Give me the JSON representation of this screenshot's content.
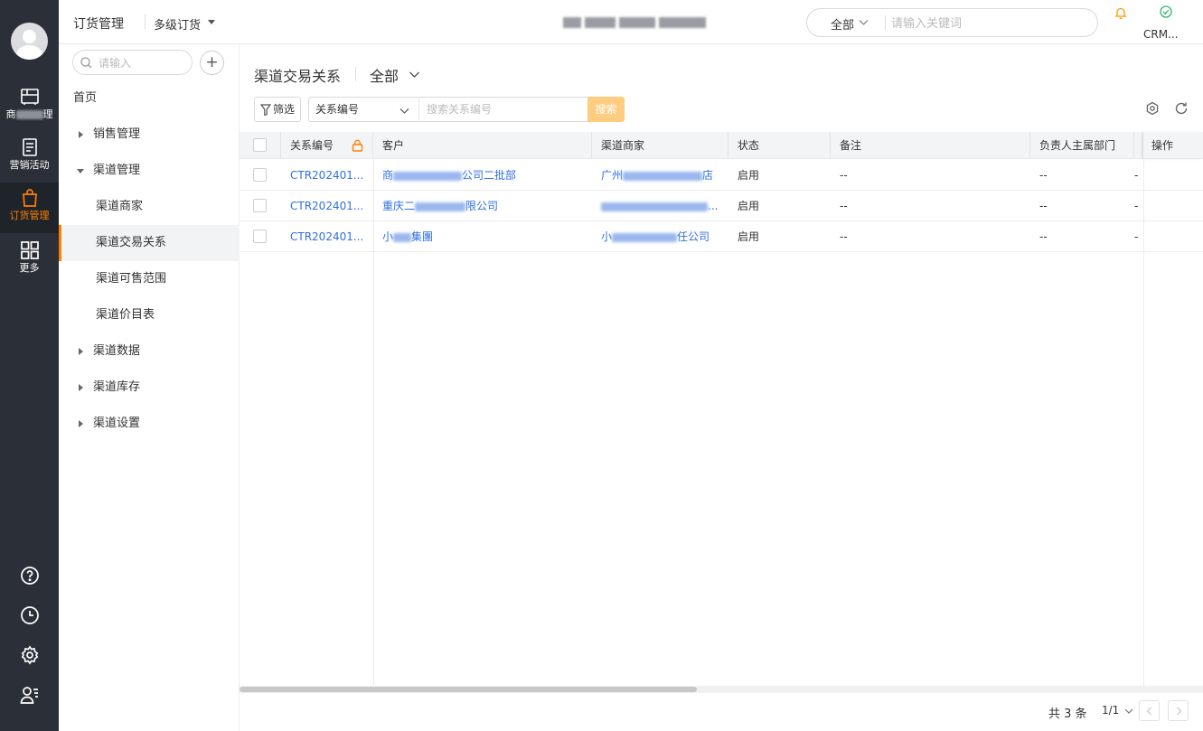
{
  "rail": {
    "items": [
      {
        "label": "商品管理",
        "icon": "product-icon"
      },
      {
        "label": "营销活动",
        "icon": "marketing-icon"
      },
      {
        "label": "订货管理",
        "icon": "shopping-bag-icon",
        "active": true
      },
      {
        "label": "更多",
        "icon": "grid-icon"
      }
    ],
    "bottom_icons": [
      "help-icon",
      "clock-icon",
      "settings-icon",
      "user-list-icon"
    ],
    "accent": "#ff8000",
    "bg": "#2b2f38"
  },
  "header": {
    "module": "订货管理",
    "submodule": "多级订货",
    "search_scope": "全部",
    "search_placeholder": "请输入关键词",
    "crm_label": "CRM..."
  },
  "sidebar": {
    "search_placeholder": "请输入",
    "add_label": "+",
    "items": [
      {
        "label": "首页",
        "level": 0,
        "arrow": "none"
      },
      {
        "label": "销售管理",
        "level": 0,
        "arrow": "right"
      },
      {
        "label": "渠道管理",
        "level": 0,
        "arrow": "down"
      },
      {
        "label": "渠道商家",
        "level": 1
      },
      {
        "label": "渠道交易关系",
        "level": 1,
        "active": true
      },
      {
        "label": "渠道可售范围",
        "level": 1
      },
      {
        "label": "渠道价目表",
        "level": 1
      },
      {
        "label": "渠道数据",
        "level": 0,
        "arrow": "right"
      },
      {
        "label": "渠道库存",
        "level": 0,
        "arrow": "right"
      },
      {
        "label": "渠道设置",
        "level": 0,
        "arrow": "right"
      }
    ]
  },
  "main": {
    "title": "渠道交易关系",
    "view_scope": "全部",
    "filter_label": "筛选",
    "field_select": "关系编号",
    "field_placeholder": "搜索关系编号",
    "search_button": "搜索"
  },
  "table": {
    "columns": [
      "关系编号",
      "客户",
      "渠道商家",
      "状态",
      "备注",
      "负责人主属部门",
      "操作"
    ],
    "rows": [
      {
        "code": "CTR202401...",
        "customer_head": "商",
        "customer_tail": "公司二批部",
        "dealer_head": "广州",
        "dealer_tail": "店",
        "status": "启用",
        "remark": "--",
        "dept": "--"
      },
      {
        "code": "CTR202401...",
        "customer_head": "重庆二",
        "customer_tail": "限公司",
        "dealer_head": "",
        "dealer_tail": "...",
        "status": "启用",
        "remark": "--",
        "dept": "--"
      },
      {
        "code": "CTR202401...",
        "customer_head": "小",
        "customer_tail": "集團",
        "dealer_head": "小",
        "dealer_tail": "任公司",
        "status": "启用",
        "remark": "--",
        "dept": "--"
      }
    ]
  },
  "footer": {
    "total": "共 3 条",
    "page": "1/1"
  },
  "colors": {
    "link": "#2f6fe4",
    "search_button": "#ffcc80",
    "header_bg": "#f3f4f6"
  }
}
